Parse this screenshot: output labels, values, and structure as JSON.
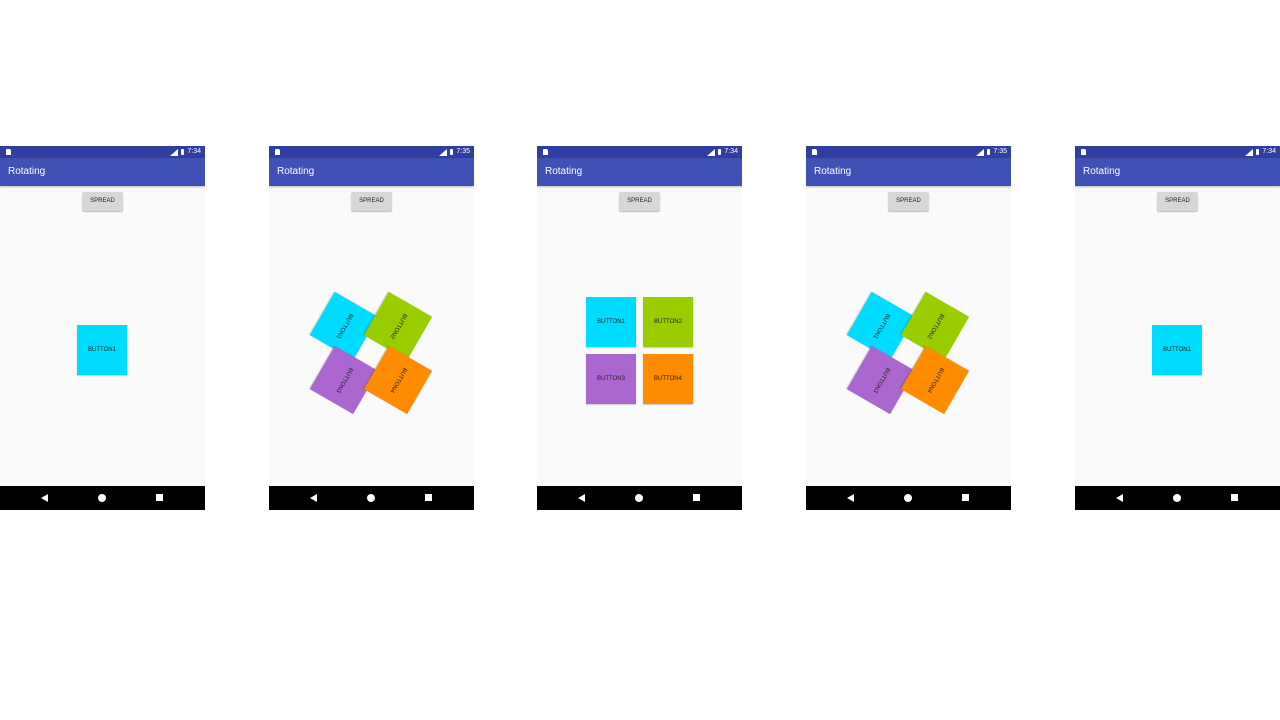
{
  "colors": {
    "status_bar": "#303f9f",
    "app_bar": "#3f51b5",
    "background": "#fafafa",
    "button1": "#00dcff",
    "button2": "#9acd00",
    "button3": "#ab66cf",
    "button4": "#ff8c00"
  },
  "phones": [
    {
      "time": "7:34",
      "title": "Rotating",
      "spread_label": "SPREAD",
      "buttons": {
        "button1": "BUTTON1"
      }
    },
    {
      "time": "7:35",
      "title": "Rotating",
      "spread_label": "SPREAD",
      "buttons": {
        "button1": "BUTTON1",
        "button2": "BUTTON2",
        "button3": "BUTTON3",
        "button4": "BUTTON4"
      }
    },
    {
      "time": "7:34",
      "title": "Rotating",
      "spread_label": "SPREAD",
      "buttons": {
        "button1": "BUTTON1",
        "button2": "BUTTON2",
        "button3": "BUTTON3",
        "button4": "BUTTON4"
      }
    },
    {
      "time": "7:35",
      "title": "Rotating",
      "spread_label": "SPREAD",
      "buttons": {
        "button1": "BUTTON1",
        "button2": "BUTTON2",
        "button3": "BUTTON3",
        "button4": "BUTTON4"
      }
    },
    {
      "time": "7:34",
      "title": "Rotating",
      "spread_label": "SPREAD",
      "buttons": {
        "button1": "BUTTON1"
      }
    }
  ]
}
